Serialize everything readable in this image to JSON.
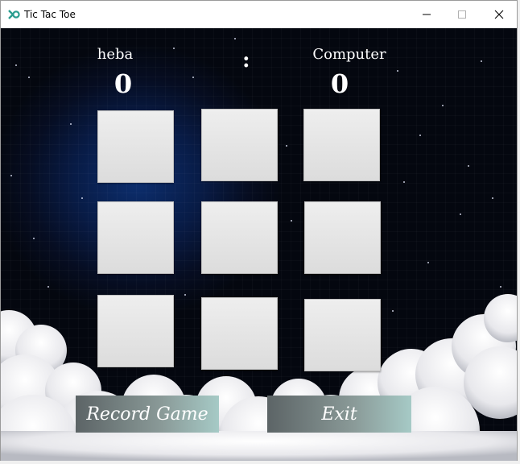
{
  "window": {
    "title": "Tic Tac Toe",
    "controls": [
      "minimize-icon",
      "maximize-icon",
      "close-icon"
    ]
  },
  "scoreboard": {
    "player1_name": "heba",
    "player2_name": "Computer",
    "separator": ":",
    "player1_score": "0",
    "player2_score": "0"
  },
  "board": {
    "cells": [
      "",
      "",
      "",
      "",
      "",
      "",
      "",
      "",
      ""
    ]
  },
  "buttons": {
    "record_game": "Record Game",
    "exit": "Exit"
  },
  "colors": {
    "sky": "#060d22",
    "glow": "#0c2e6e",
    "cell": "#e6e6e6",
    "button_start": "#5c6466",
    "button_end": "#a6cac6"
  }
}
